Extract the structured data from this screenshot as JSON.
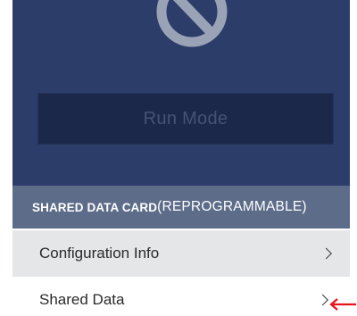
{
  "run_mode": {
    "label": "Run Mode",
    "icon": "prohibited-icon"
  },
  "shared_data_card": {
    "title_bold": "SHARED DATA CARD",
    "title_suffix": "(REPROGRAMMABLE)"
  },
  "menu": {
    "items": [
      {
        "label": "Configuration Info",
        "icon": "chevron-right-icon"
      },
      {
        "label": "Shared Data",
        "icon": "chevron-right-icon"
      }
    ]
  },
  "annotation": {
    "icon": "red-arrow-left-icon",
    "color": "#e8141b"
  },
  "colors": {
    "hero_background": "#2c3d6a",
    "card_header_background": "#5d6c89",
    "menu_row_background": "#e5e6e8"
  }
}
